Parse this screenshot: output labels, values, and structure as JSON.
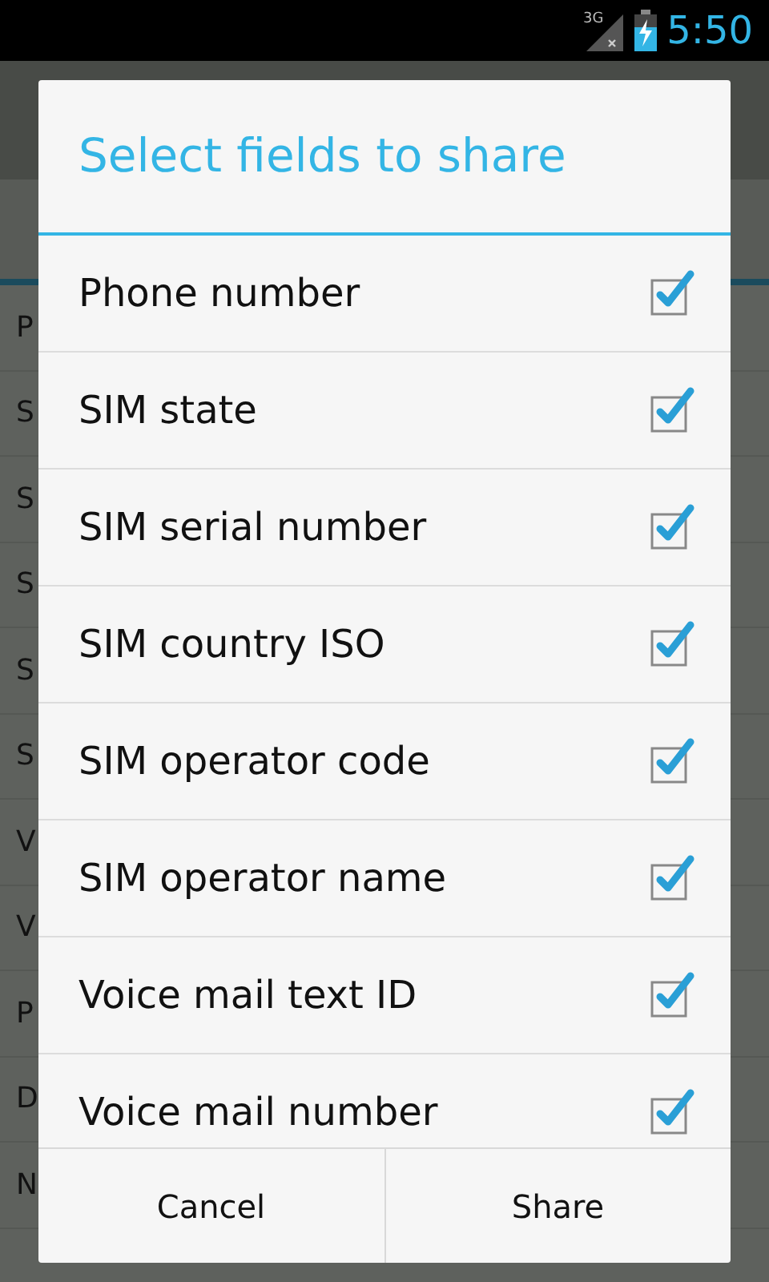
{
  "status_bar": {
    "network": "3G",
    "time": "5:50"
  },
  "background_list": [
    "P",
    "S",
    "S",
    "S",
    "S",
    "S",
    "V",
    "V",
    "P",
    "D",
    "N"
  ],
  "dialog": {
    "title": "Select fields to share",
    "fields": [
      {
        "label": "Phone number",
        "checked": true
      },
      {
        "label": "SIM state",
        "checked": true
      },
      {
        "label": "SIM serial number",
        "checked": true
      },
      {
        "label": "SIM country ISO",
        "checked": true
      },
      {
        "label": "SIM operator code",
        "checked": true
      },
      {
        "label": "SIM operator name",
        "checked": true
      },
      {
        "label": "Voice mail text ID",
        "checked": true
      },
      {
        "label": "Voice mail number",
        "checked": true
      }
    ],
    "buttons": [
      "Cancel",
      "Share"
    ]
  }
}
